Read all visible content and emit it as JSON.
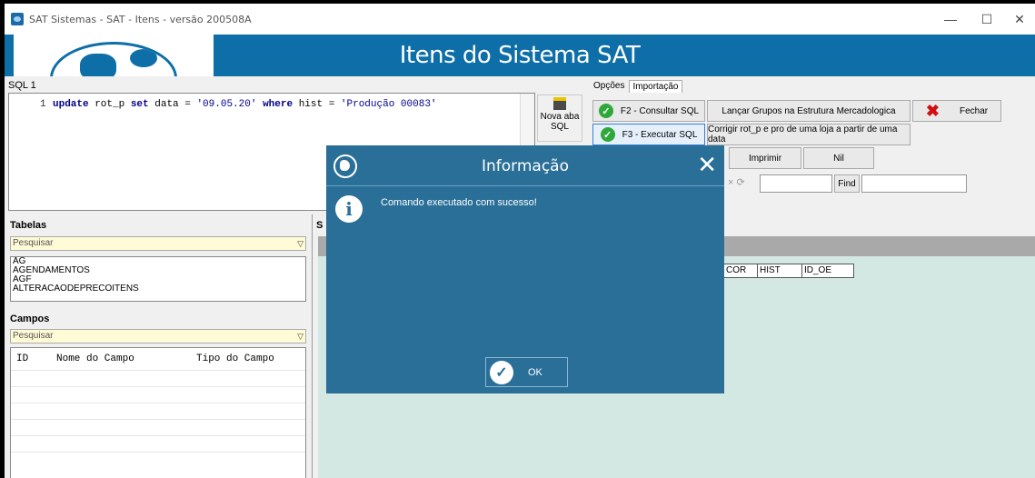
{
  "window": {
    "title": "SAT Sistemas - SAT - Itens - versão 200508A",
    "minimize": "—",
    "maximize": "☐",
    "close": "✕"
  },
  "banner": {
    "title": "Itens do Sistema SAT"
  },
  "sql": {
    "tab_label": "SQL 1",
    "line_number": "1",
    "code_kw1": "update",
    "code_t1": " rot_p ",
    "code_kw2": "set",
    "code_t2": " data = ",
    "code_s1": "'09.05.20'",
    "code_t3": " ",
    "code_kw3": "where",
    "code_t4": " hist = ",
    "code_s2": "'Produção 00083'",
    "nova_aba_label": "Nova aba SQL"
  },
  "options": {
    "tabs": [
      "Opções",
      "Importação"
    ],
    "consultar": "F2 - Consultar SQL",
    "executar": "F3 - Executar SQL",
    "lancar": "Lançar Grupos na Estrutura Mercadologica",
    "fechar": "Fechar",
    "corrigir": "Corrigir rot_p e pro de uma loja a partir de uma data",
    "imprimir": "Imprimir",
    "nil": "Nil",
    "find": "Find"
  },
  "tabelas": {
    "header": "Tabelas",
    "search_placeholder": "Pesquisar",
    "items": [
      "AG",
      "AGENDAMENTOS",
      "AGF",
      "ALTERACAODEPRECOITENS"
    ]
  },
  "campos": {
    "header": "Campos",
    "search_placeholder": "Pesquisar",
    "columns": [
      "ID",
      "Nome do Campo",
      "Tipo do Campo"
    ]
  },
  "results": {
    "header_abbrev": "S",
    "columns": [
      "COR",
      "HIST",
      "ID_OE"
    ]
  },
  "dialog": {
    "title": "Informação",
    "message": "Comando executado com sucesso!",
    "ok": "OK"
  },
  "colors": {
    "banner": "#0d6ea8",
    "dialog": "#2a6f98",
    "results_bg": "#d4e8e3",
    "search_bg": "#fffbd6"
  }
}
